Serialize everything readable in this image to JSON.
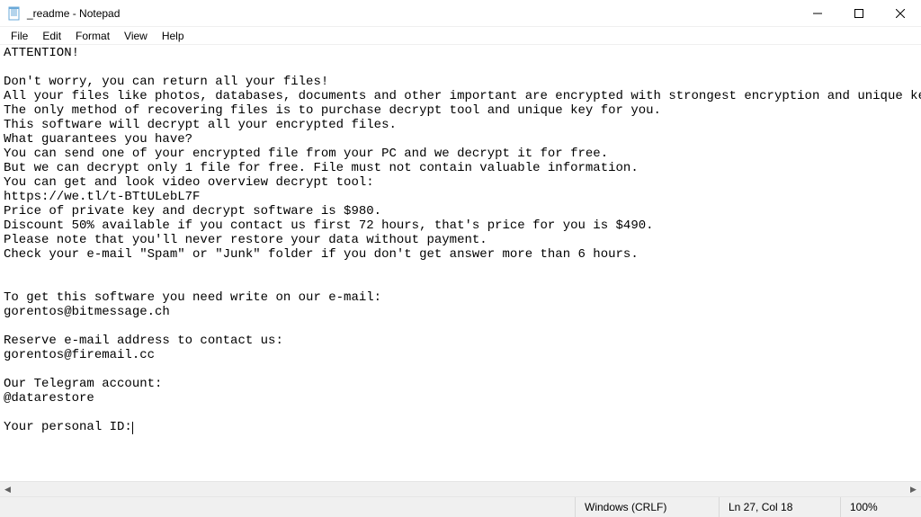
{
  "window": {
    "title": "_readme - Notepad"
  },
  "menu": {
    "file": "File",
    "edit": "Edit",
    "format": "Format",
    "view": "View",
    "help": "Help"
  },
  "document": {
    "lines": [
      "ATTENTION!",
      "",
      "Don't worry, you can return all your files!",
      "All your files like photos, databases, documents and other important are encrypted with strongest encryption and unique key.",
      "The only method of recovering files is to purchase decrypt tool and unique key for you.",
      "This software will decrypt all your encrypted files.",
      "What guarantees you have?",
      "You can send one of your encrypted file from your PC and we decrypt it for free.",
      "But we can decrypt only 1 file for free. File must not contain valuable information.",
      "You can get and look video overview decrypt tool:",
      "https://we.tl/t-BTtULebL7F",
      "Price of private key and decrypt software is $980.",
      "Discount 50% available if you contact us first 72 hours, that's price for you is $490.",
      "Please note that you'll never restore your data without payment.",
      "Check your e-mail \"Spam\" or \"Junk\" folder if you don't get answer more than 6 hours.",
      "",
      "",
      "To get this software you need write on our e-mail:",
      "gorentos@bitmessage.ch",
      "",
      "Reserve e-mail address to contact us:",
      "gorentos@firemail.cc",
      "",
      "Our Telegram account:",
      "@datarestore",
      "",
      "Your personal ID:"
    ]
  },
  "statusbar": {
    "encoding": "Windows (CRLF)",
    "position": "Ln 27, Col 18",
    "zoom": "100%"
  }
}
